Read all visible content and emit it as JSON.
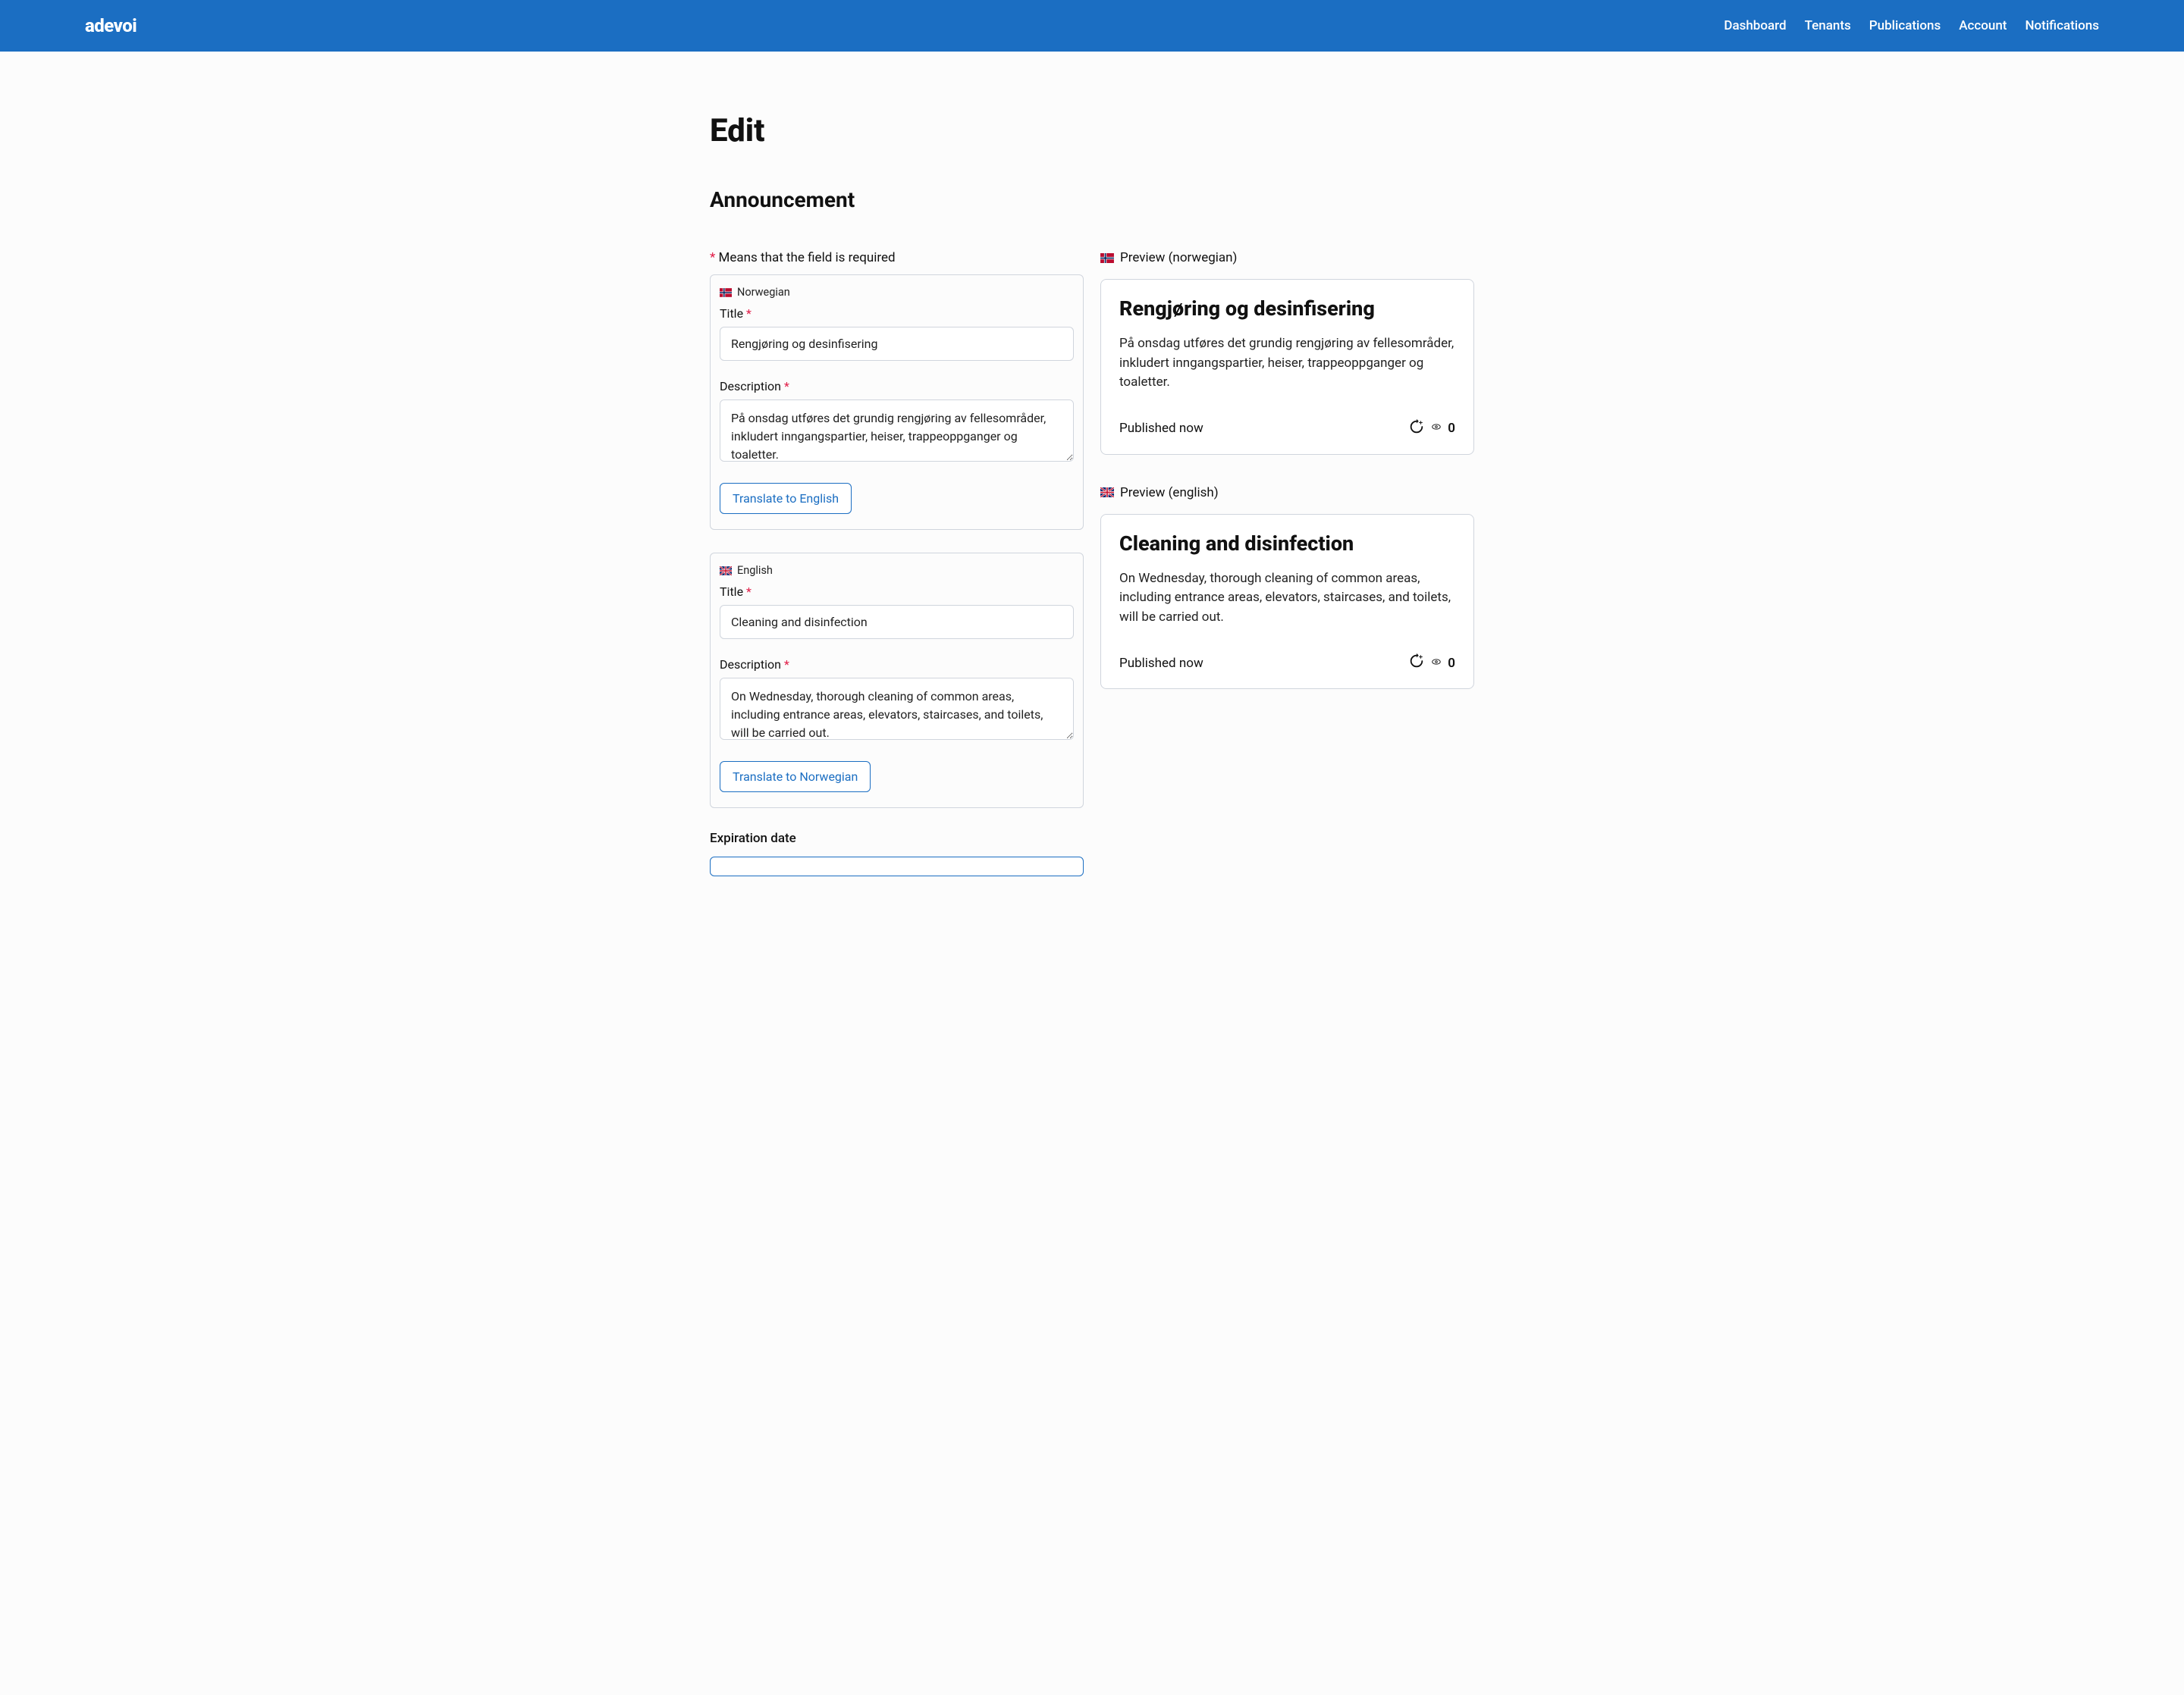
{
  "brand": "adevoi",
  "nav": {
    "dashboard": "Dashboard",
    "tenants": "Tenants",
    "publications": "Publications",
    "account": "Account",
    "notifications": "Notifications"
  },
  "page_title": "Edit",
  "section_title": "Announcement",
  "required_note_prefix": "*",
  "required_note_text": " Means that the field is required",
  "labels": {
    "title": "Title",
    "description": "Description",
    "expiration_date": "Expiration date"
  },
  "norwegian": {
    "lang_name": "Norwegian",
    "title_value": "Rengjøring og desinfisering",
    "description_value": "På onsdag utføres det grundig rengjøring av fellesområder, inkludert inngangspartier, heiser, trappeoppganger og toaletter.",
    "translate_button": "Translate to English",
    "preview_label": "Preview (norwegian)"
  },
  "english": {
    "lang_name": "English",
    "title_value": "Cleaning and disinfection",
    "description_value": "On Wednesday, thorough cleaning of common areas, including entrance areas, elevators, staircases, and toilets, will be carried out.",
    "translate_button": "Translate to Norwegian",
    "preview_label": "Preview (english)"
  },
  "preview": {
    "published_text": "Published now",
    "refresh_count": "0"
  }
}
